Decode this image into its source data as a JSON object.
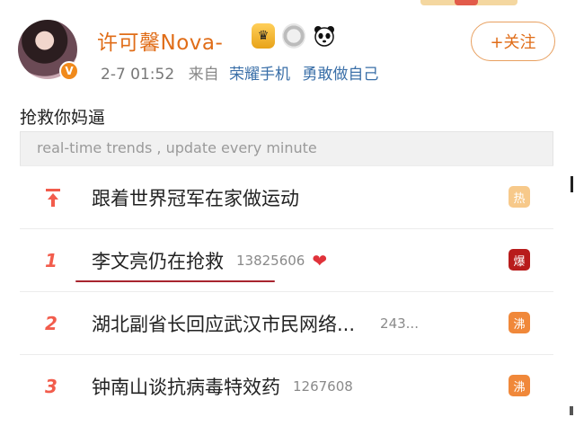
{
  "post": {
    "username": "许可馨Nova-",
    "verified_badge": "V",
    "badges": [
      "crown-icon",
      "medal-icon",
      "panda-icon"
    ],
    "time": "2-7 01:52",
    "source_prefix": "来自",
    "device": "荣耀手机",
    "device_slogan": "勇敢做自己",
    "follow_label": "+关注",
    "text": "抢救你妈逼"
  },
  "trends": {
    "header": "real-time trends , update every minute",
    "items": [
      {
        "rank": "",
        "pinned": true,
        "title": "跟着世界冠军在家做运动",
        "count": "",
        "tag": "热",
        "tag_type": "hot"
      },
      {
        "rank": "1",
        "pinned": false,
        "title": "李文亮仍在抢救",
        "count": "13825606",
        "heart": "❤",
        "tag": "爆",
        "tag_type": "boom"
      },
      {
        "rank": "2",
        "pinned": false,
        "title": "湖北副省长回应武汉市民网络...",
        "count": "243...",
        "tag": "沸",
        "tag_type": "surge"
      },
      {
        "rank": "3",
        "pinned": false,
        "title": "钟南山谈抗病毒特效药",
        "count": "1267608",
        "tag": "沸",
        "tag_type": "surge"
      }
    ]
  },
  "colors": {
    "username": "#e06d18",
    "link": "#3a6fa8",
    "rank": "#f25c4c",
    "tag_hot": "#f7c98a",
    "tag_boom": "#b81c1c",
    "tag_surge": "#f0883a",
    "underline": "#a8242e"
  }
}
